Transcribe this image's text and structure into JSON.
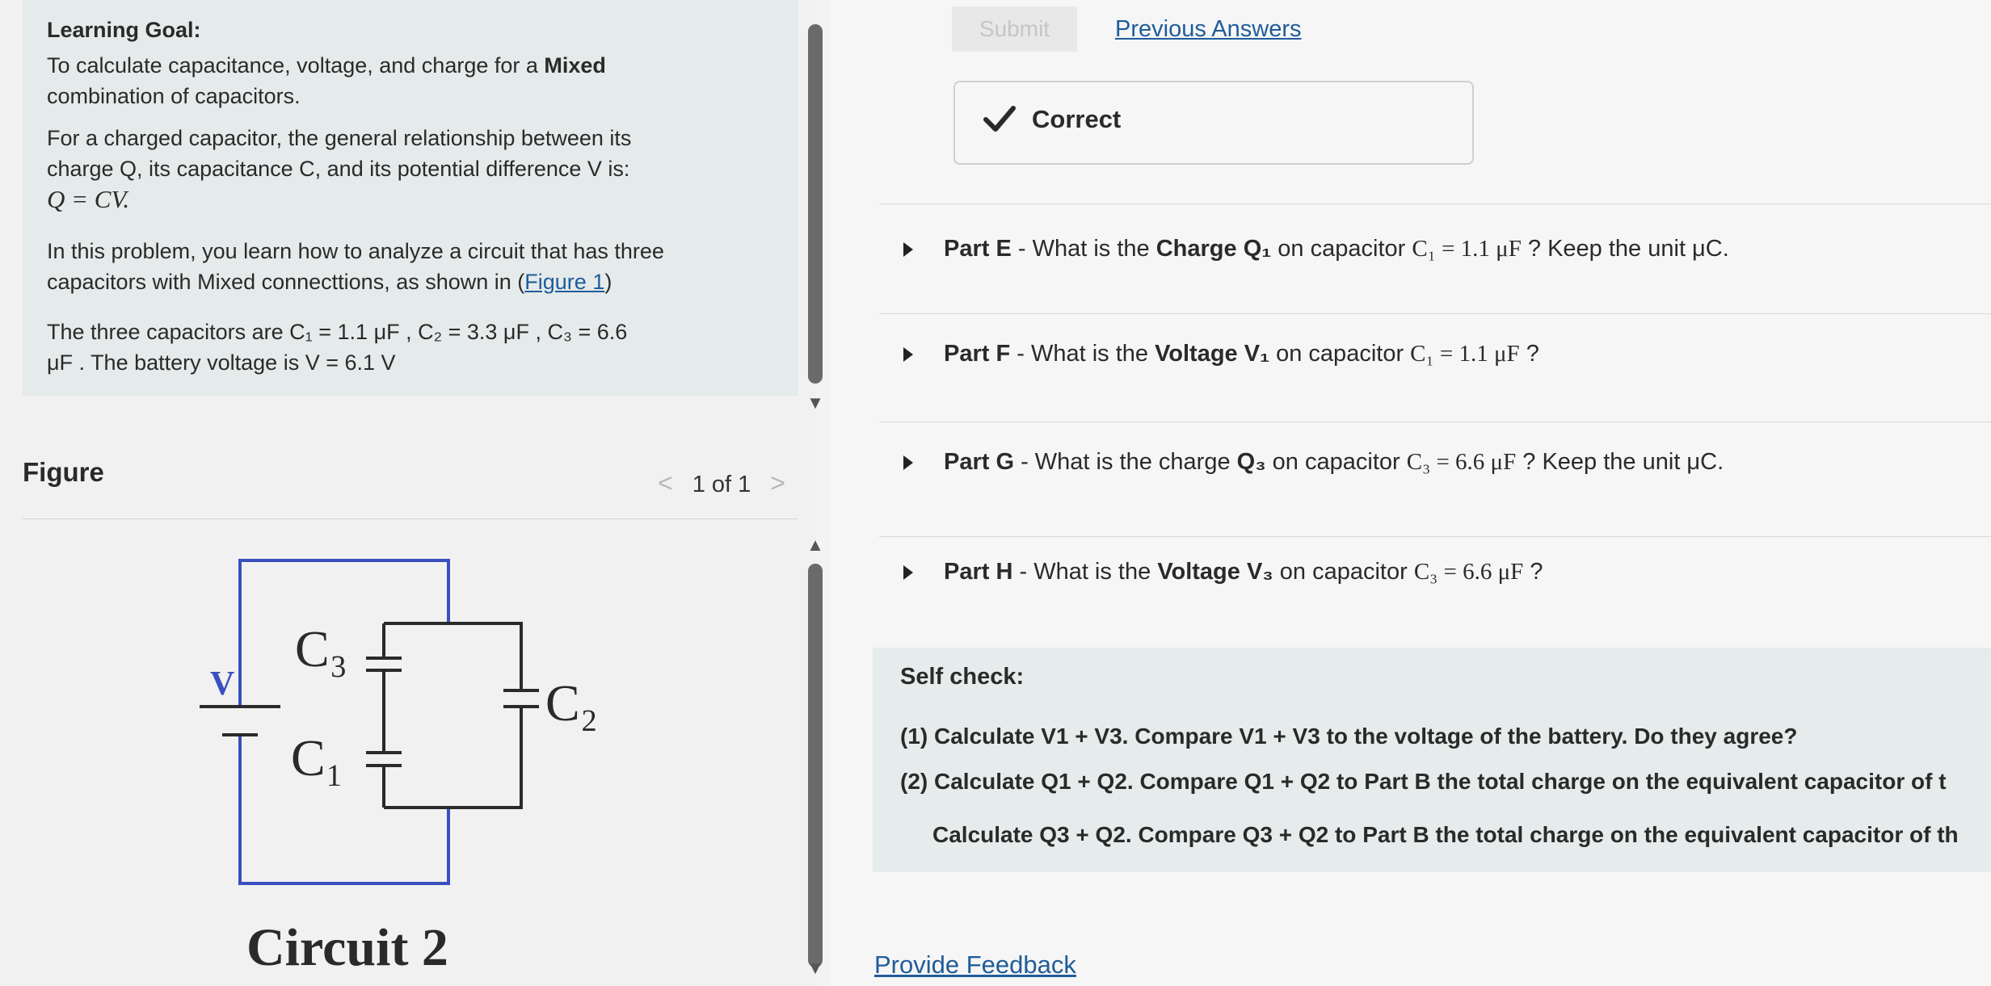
{
  "left": {
    "goal_title": "Learning Goal:",
    "goal_line1_pre": "To calculate capacitance, voltage, and charge for a ",
    "goal_line1_bold": "Mixed",
    "goal_line2": "combination of capacitors.",
    "rel_line1": "For a charged capacitor, the general relationship between its",
    "rel_line2": "charge Q, its capacitance C, and its potential difference V is:",
    "rel_formula": "Q = CV.",
    "prob_line1": "In this problem, you learn how to analyze a circuit  that has three",
    "prob_line2_pre": "capacitors with Mixed connecttions, as shown in (",
    "prob_link": "Figure 1",
    "prob_line2_post": ")",
    "caps_line1": "The three capacitors are C₁ = 1.1 μF , C₂ = 3.3 μF , C₃ = 6.6",
    "caps_line2": "μF . The battery voltage is V = 6.1 V",
    "figure_label": "Figure",
    "pager": {
      "prev": "<",
      "text": "1 of 1",
      "next": ">"
    }
  },
  "circuit": {
    "v_label": "V",
    "c3_label": "C₃",
    "c1_label": "C₁",
    "c2_label": "C₂",
    "caption": "Circuit 2"
  },
  "right": {
    "submit": "Submit",
    "previous_answers": "Previous Answers",
    "correct": "Correct",
    "parts": [
      {
        "label": "Part E",
        "pre": " - What is the ",
        "bold": "Charge Q₁",
        "mid": " on capacitor ",
        "cap": "C₁ = 1.1 μF",
        "post": " ? Keep the unit μC."
      },
      {
        "label": "Part F",
        "pre": " - What is the ",
        "bold": "Voltage V₁",
        "mid": " on capacitor ",
        "cap": "C₁ = 1.1 μF",
        "post": " ?"
      },
      {
        "label": "Part G",
        "pre": " - What is the charge ",
        "bold": "Q₃",
        "mid": " on capacitor ",
        "cap": "C₃ = 6.6 μF",
        "post": " ? Keep the unit μC."
      },
      {
        "label": "Part H",
        "pre": " - What is the ",
        "bold": "Voltage V₃",
        "mid": " on capacitor ",
        "cap": "C₃ = 6.6 μF",
        "post": " ?"
      }
    ],
    "self_check": {
      "title": "Self check:",
      "q1": "(1) Calculate V1 + V3. Compare V1 + V3 to the voltage of the battery. Do they agree?",
      "q2": "(2) Calculate Q1 + Q2. Compare Q1 + Q2 to Part B the total charge on the equivalent capacitor of t",
      "q3": "Calculate Q3 + Q2. Compare Q3 + Q2 to Part B the total charge on the equivalent capacitor of th"
    },
    "feedback": "Provide Feedback"
  }
}
